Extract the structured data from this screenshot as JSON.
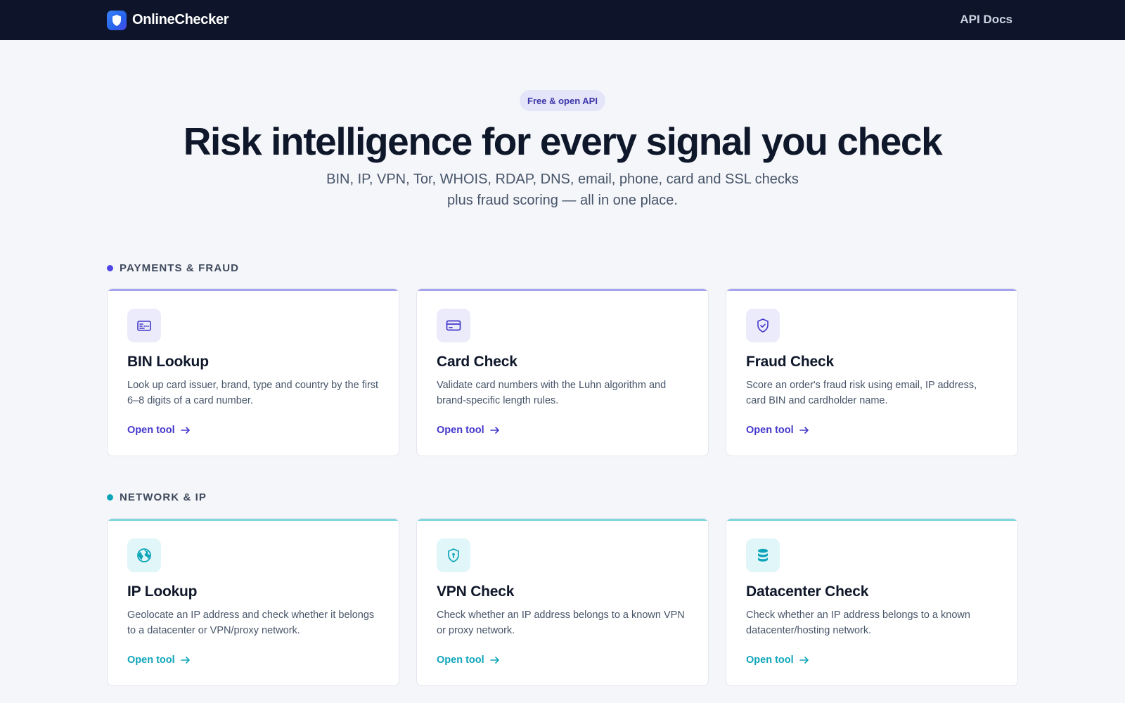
{
  "header": {
    "brand": "OnlineChecker",
    "nav_link": "API Docs"
  },
  "hero": {
    "badge": "Free & open API",
    "title": "Risk intelligence for every signal you check",
    "subtitle_line1": "BIN, IP, VPN, Tor, WHOIS, RDAP, DNS, email, phone, card and SSL checks",
    "subtitle_line2": "plus fraud scoring — all in one place."
  },
  "sections": [
    {
      "label": "PAYMENTS & FRAUD",
      "accent": "#4f46e5",
      "cards": [
        {
          "title": "BIN Lookup",
          "icon": "card-details-icon",
          "description": "Look up card issuer, brand, type and country by the first 6–8 digits of a card number.",
          "link": "Open tool"
        },
        {
          "title": "Card Check",
          "icon": "credit-card-icon",
          "description": "Validate card numbers with the Luhn algorithm and brand-specific length rules.",
          "link": "Open tool"
        },
        {
          "title": "Fraud Check",
          "icon": "shield-check-icon",
          "description": "Score an order's fraud risk using email, IP address, card BIN and cardholder name.",
          "link": "Open tool"
        }
      ]
    },
    {
      "label": "NETWORK & IP",
      "accent": "#0ea5b9",
      "cards": [
        {
          "title": "IP Lookup",
          "icon": "globe-icon",
          "description": "Geolocate an IP address and check whether it belongs to a datacenter or VPN/proxy network.",
          "link": "Open tool"
        },
        {
          "title": "VPN Check",
          "icon": "shield-lock-icon",
          "description": "Check whether an IP address belongs to a known VPN or proxy network.",
          "link": "Open tool"
        },
        {
          "title": "Datacenter Check",
          "icon": "database-icon",
          "description": "Check whether an IP address belongs to a known datacenter/hosting network.",
          "link": "Open tool"
        }
      ]
    }
  ]
}
